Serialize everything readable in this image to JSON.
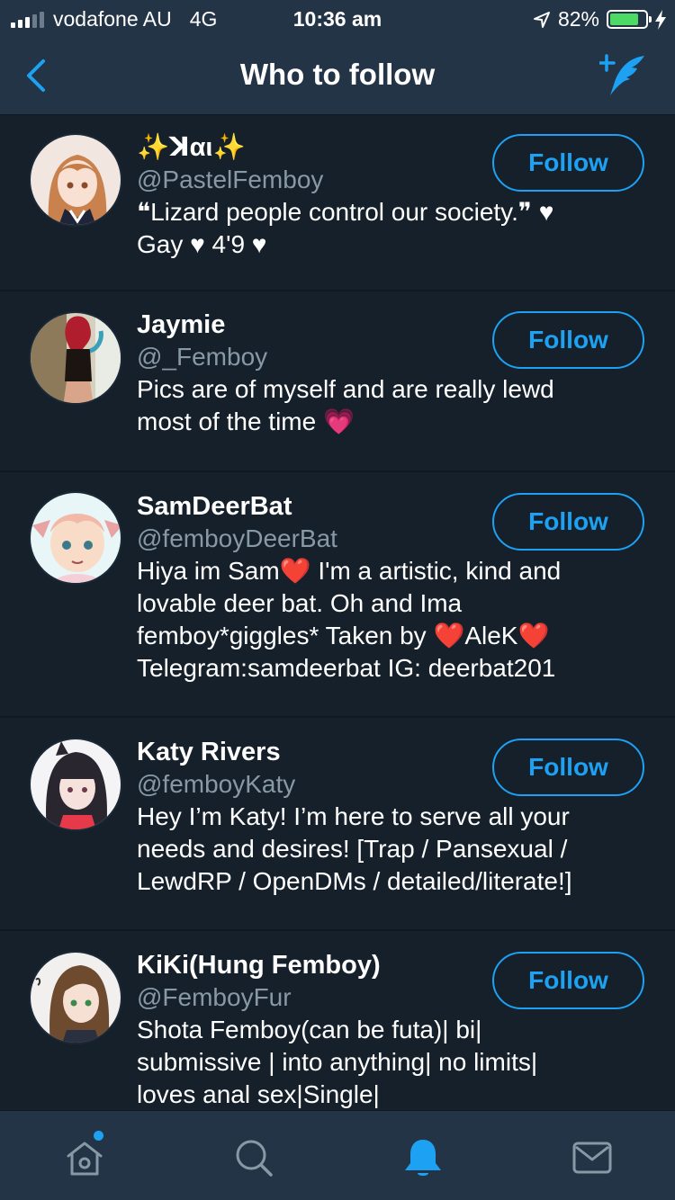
{
  "status_bar": {
    "carrier": "vodafone AU",
    "network": "4G",
    "time": "10:36 am",
    "battery": "82%",
    "battery_level": 0.82
  },
  "header": {
    "title": "Who to follow"
  },
  "users": [
    {
      "name": "✨ꓘαι✨",
      "handle": "@PastelFemboy",
      "bio": "❝Lizard people control our society.❞ ♥\nGay ♥ 4'9 ♥",
      "button": "Follow"
    },
    {
      "name": "Jaymie",
      "handle": "@_Femboy",
      "bio": "Pics are of myself and are really lewd\nmost of the time 💗",
      "button": "Follow"
    },
    {
      "name": "SamDeerBat",
      "handle": "@femboyDeerBat",
      "bio": "Hiya im Sam❤️ I'm a artistic, kind and\nlovable deer bat. Oh and Ima\nfemboy*giggles* Taken by ❤️AleK❤️\nTelegram:samdeerbat IG: deerbat201",
      "button": "Follow"
    },
    {
      "name": "Katy Rivers",
      "handle": "@femboyKaty",
      "bio": "Hey I’m Katy! I’m here to serve all your\nneeds and desires! [Trap / Pansexual /\nLewdRP / OpenDMs / detailed/literate!]",
      "button": "Follow"
    },
    {
      "name": "KiKi(Hung Femboy)",
      "handle": "@FemboyFur",
      "bio": "Shota Femboy(can be futa)| bi|\nsubmissive | into anything| no limits|\nloves anal sex|Single|",
      "button": "Follow"
    }
  ],
  "tabs": [
    {
      "icon": "home-icon",
      "active": false,
      "has_notification_dot": true
    },
    {
      "icon": "search-icon",
      "active": false
    },
    {
      "icon": "notifications-bell-icon",
      "active": true
    },
    {
      "icon": "messages-envelope-icon",
      "active": false
    }
  ],
  "colors": {
    "background": "#15202b",
    "bar": "#243447",
    "accent": "#1da1f2",
    "secondary_text": "#8899a6"
  }
}
